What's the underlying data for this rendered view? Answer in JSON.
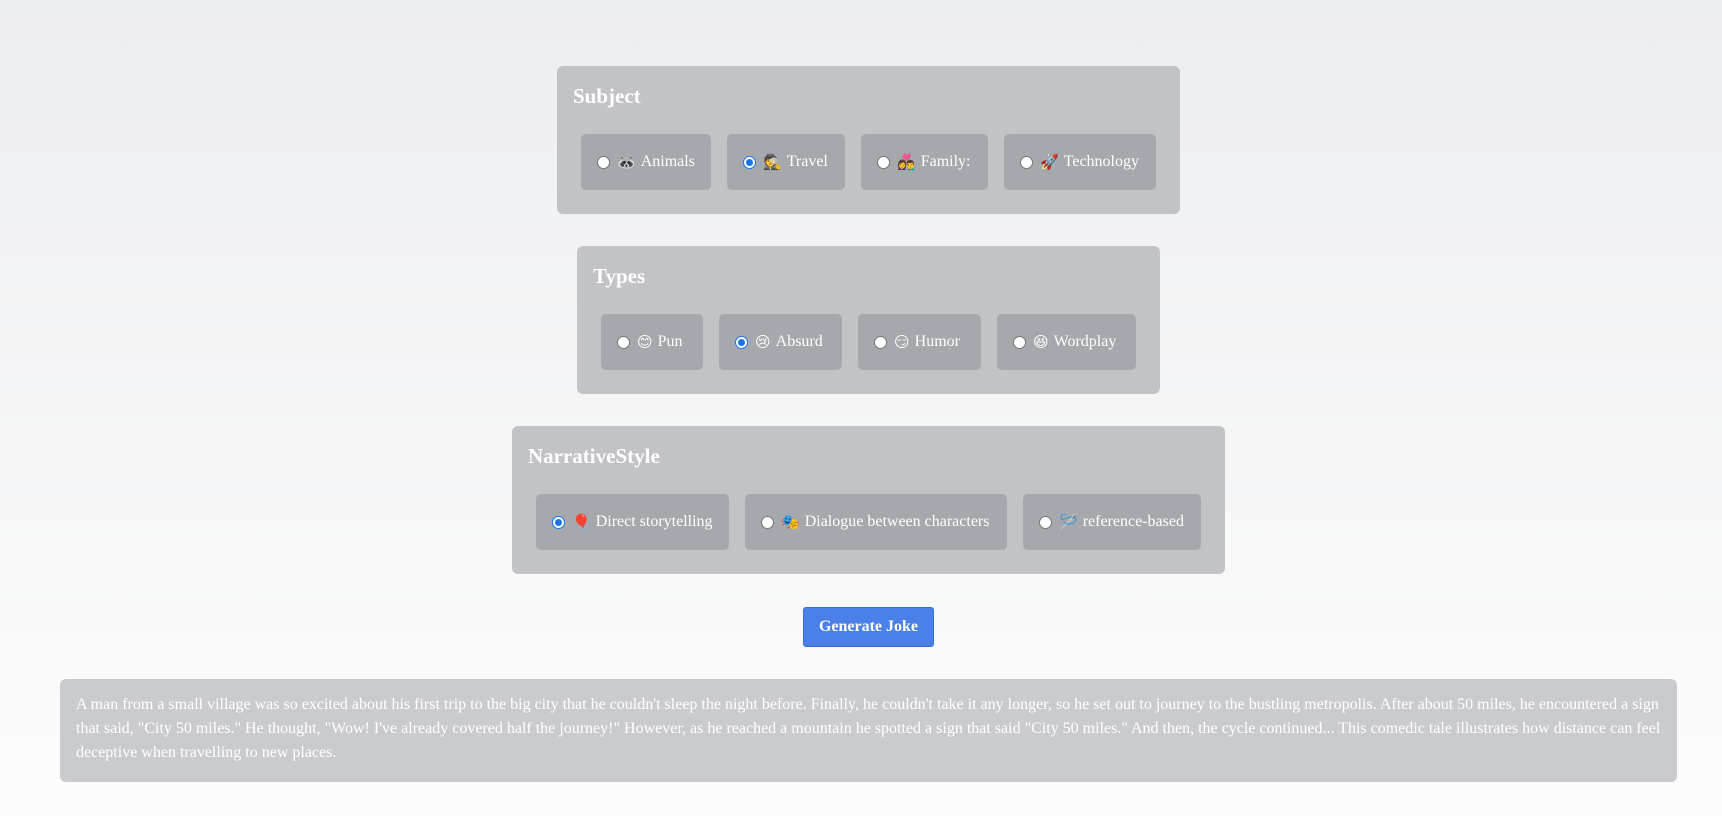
{
  "subject": {
    "title": "Subject",
    "options": [
      {
        "emoji": "🦝",
        "label": "Animals",
        "checked": false
      },
      {
        "emoji": "🕵",
        "label": "Travel",
        "checked": true
      },
      {
        "emoji": "👩‍❤️‍👨",
        "label": "Family:",
        "checked": false
      },
      {
        "emoji": "🚀",
        "label": "Technology",
        "checked": false
      }
    ]
  },
  "types": {
    "title": "Types",
    "options": [
      {
        "emoji": "😊",
        "label": "Pun",
        "checked": false
      },
      {
        "emoji": "😢",
        "label": "Absurd",
        "checked": true
      },
      {
        "emoji": "😏",
        "label": "Humor",
        "checked": false
      },
      {
        "emoji": "😆",
        "label": "Wordplay",
        "checked": false
      }
    ]
  },
  "narrative": {
    "title": "NarrativeStyle",
    "options": [
      {
        "emoji": "🎈",
        "label": "Direct storytelling",
        "checked": true
      },
      {
        "emoji": "🎭",
        "label": "Dialogue between characters",
        "checked": false
      },
      {
        "emoji": "🪡",
        "label": "reference-based",
        "checked": false
      }
    ]
  },
  "generate_label": "Generate Joke",
  "joke_text": "A man from a small village was so excited about his first trip to the big city that he couldn't sleep the night before. Finally, he couldn't take it any longer, so he set out to journey to the bustling metropolis. After about 50 miles, he encountered a sign that said, \"City 50 miles.\" He thought, \"Wow! I've already covered half the journey!\" However, as he reached a mountain he spotted a sign that said \"City 50 miles.\" And then, the cycle continued... This comedic tale illustrates how distance can feel deceptive when travelling to new places."
}
